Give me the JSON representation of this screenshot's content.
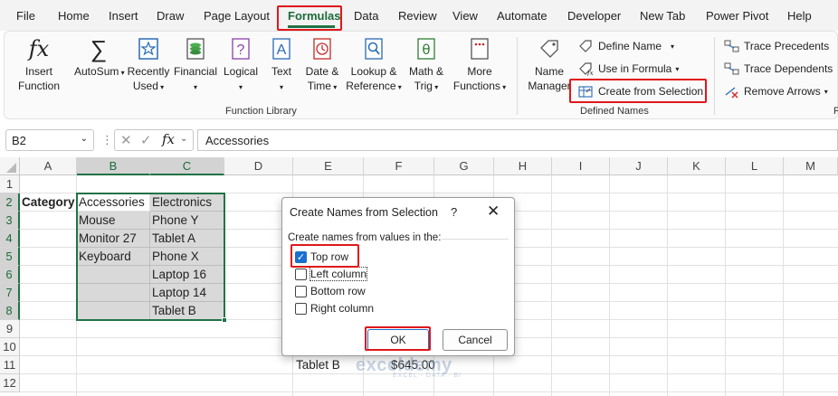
{
  "menu": {
    "tabs": [
      "File",
      "Home",
      "Insert",
      "Draw",
      "Page Layout",
      "Formulas",
      "Data",
      "Review",
      "View",
      "Automate",
      "Developer",
      "New Tab",
      "Power Pivot",
      "Help"
    ],
    "active": "Formulas"
  },
  "ribbon": {
    "function_library": {
      "insert_function": [
        "Insert",
        "Function"
      ],
      "autosum": "AutoSum",
      "recently_used": [
        "Recently",
        "Used"
      ],
      "financial": "Financial",
      "logical": "Logical",
      "text": "Text",
      "date_time": [
        "Date &",
        "Time"
      ],
      "lookup_reference": [
        "Lookup &",
        "Reference"
      ],
      "math_trig": [
        "Math &",
        "Trig"
      ],
      "more_functions": [
        "More",
        "Functions"
      ],
      "group_label": "Function Library"
    },
    "defined_names": {
      "name_manager": [
        "Name",
        "Manager"
      ],
      "define_name": "Define Name",
      "use_in_formula": "Use in Formula",
      "create_from_selection": "Create from Selection",
      "group_label": "Defined Names"
    },
    "formula_auditing": {
      "trace_precedents": "Trace Precedents",
      "trace_dependents": "Trace Dependents",
      "remove_arrows": "Remove Arrows",
      "group_label_partial": "F"
    }
  },
  "formula_bar": {
    "name_box": "B2",
    "fx_label": "fx",
    "content": "Accessories"
  },
  "sheet": {
    "columns": [
      "A",
      "B",
      "C",
      "D",
      "E",
      "F",
      "G",
      "H",
      "I",
      "J",
      "K",
      "L",
      "M"
    ],
    "rows": [
      "1",
      "2",
      "3",
      "4",
      "5",
      "6",
      "7",
      "8",
      "9",
      "10",
      "11",
      "12"
    ],
    "cells": {
      "A2": "Category",
      "B2": "Accessories",
      "C2": "Electronics",
      "B3": "Mouse",
      "C3": "Phone Y",
      "B4": "Monitor 27",
      "C4": "Tablet A",
      "B5": "Keyboard",
      "C5": "Phone X",
      "C6": "Laptop 16",
      "C7": "Laptop 14",
      "C8": "Tablet B",
      "E11": "Tablet B",
      "F11": "$645.00"
    }
  },
  "dialog": {
    "title": "Create Names from Selection",
    "help": "?",
    "close": "✕",
    "prompt": "Create names from values in the:",
    "options": [
      {
        "label": "Top row",
        "checked": true
      },
      {
        "label": "Left column",
        "checked": false
      },
      {
        "label": "Bottom row",
        "checked": false
      },
      {
        "label": "Right column",
        "checked": false
      }
    ],
    "ok": "OK",
    "cancel": "Cancel"
  },
  "watermark": {
    "main": "exceldemy",
    "sub": "EXCEL · DATA · BI"
  },
  "colors": {
    "accent": "#217346",
    "highlight": "#e0171a",
    "check": "#1a6fd0"
  }
}
